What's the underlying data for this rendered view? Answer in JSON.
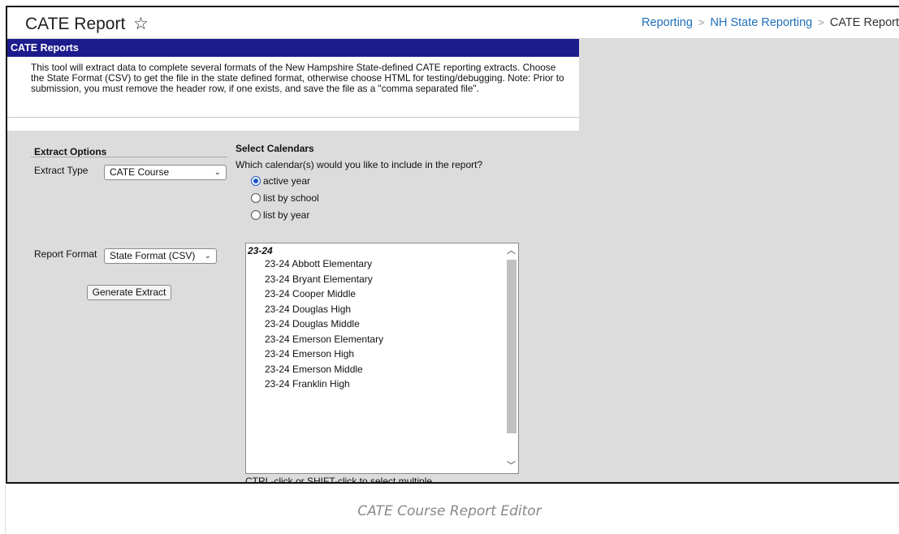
{
  "header": {
    "title": "CATE Report",
    "favorite_icon": "star-outline-icon",
    "breadcrumb": [
      "Reporting",
      "NH State Reporting",
      "CATE Report"
    ]
  },
  "panel": {
    "title": "CATE Reports",
    "description": "This tool will extract data to complete several formats of the New Hampshire State-defined CATE reporting extracts. Choose the State Format (CSV) to get the file in the state defined format, otherwise choose HTML for testing/debugging. Note: Prior to submission, you must remove the header row, if one exists, and save the file as a \"comma separated file\"."
  },
  "extract_options": {
    "heading": "Extract Options",
    "extract_type_label": "Extract Type",
    "extract_type_value": "CATE Course",
    "report_format_label": "Report Format",
    "report_format_value": "State Format (CSV)",
    "generate_button": "Generate Extract"
  },
  "calendars": {
    "heading": "Select Calendars",
    "question": "Which calendar(s) would you like to include in the report?",
    "options": [
      {
        "label": "active year",
        "checked": true
      },
      {
        "label": "list by school",
        "checked": false
      },
      {
        "label": "list by year",
        "checked": false
      }
    ],
    "group_label": "23-24",
    "items": [
      "23-24 Abbott Elementary",
      "23-24 Bryant Elementary",
      "23-24 Cooper Middle",
      "23-24 Douglas High",
      "23-24 Douglas Middle",
      "23-24 Emerson Elementary",
      "23-24 Emerson High",
      "23-24 Emerson Middle",
      "23-24 Franklin High"
    ],
    "hint": "CTRL-click or SHIFT-click to select multiple"
  },
  "caption": "CATE Course Report Editor",
  "colors": {
    "panel_header": "#1c1c8c",
    "link": "#1e6fb8",
    "background": "#dcdcdc"
  }
}
